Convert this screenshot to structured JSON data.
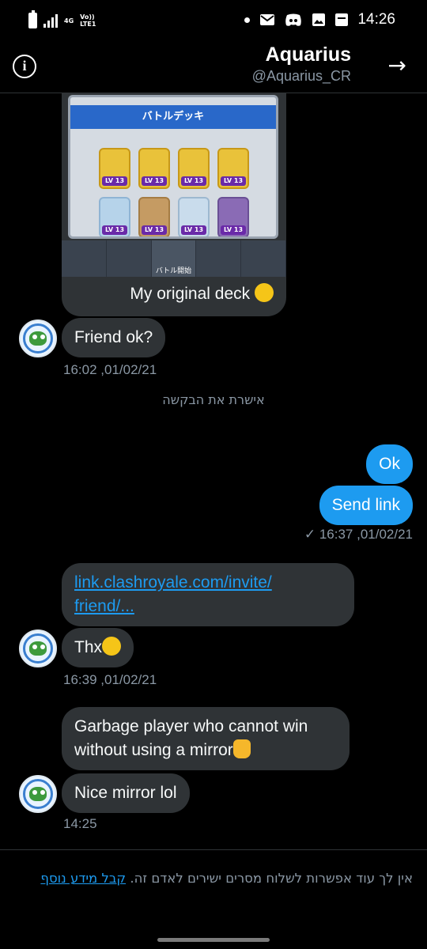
{
  "status_bar": {
    "network_labels": [
      "4G",
      "Vo))",
      "LTE1"
    ],
    "time": "14:26",
    "icons": [
      "battery-icon",
      "signal-icon",
      "dot-icon",
      "mail-icon",
      "discord-icon",
      "gallery-icon",
      "notification-icon"
    ]
  },
  "header": {
    "title": "Aquarius",
    "handle": "@Aquarius_CR",
    "info_icon": "i",
    "back_icon": "→"
  },
  "media": {
    "banner": "バトルデッキ",
    "card_level": "LV 13",
    "toolbar_label": "バトル開始",
    "caption": "My original deck"
  },
  "messages": [
    {
      "text": "Friend ok?",
      "timestamp": "16:02 ,01/02/21"
    },
    {
      "system": "אישרת את הבקשה"
    },
    {
      "text": "Ok"
    },
    {
      "text": "Send link",
      "timestamp": "✓ 16:37 ,01/02/21"
    },
    {
      "text_line1": "link.clashroyale.com/invite/",
      "text_line2": "friend/..."
    },
    {
      "text": "Thx",
      "timestamp": "16:39 ,01/02/21"
    },
    {
      "text_line1": "Garbage player who cannot win",
      "text_line2": "without using a mirror"
    },
    {
      "text": "Nice mirror lol",
      "timestamp": "14:25"
    }
  ],
  "footer": {
    "text": "אין לך עוד אפשרות לשלוח מסרים ישירים לאדם זה.",
    "link": "קבל מידע נוסף"
  },
  "colors": {
    "background": "#000000",
    "incoming_bubble": "#2f3336",
    "outgoing_bubble": "#1d9bf0",
    "muted_text": "#8b98a5",
    "link": "#1d9bf0"
  }
}
